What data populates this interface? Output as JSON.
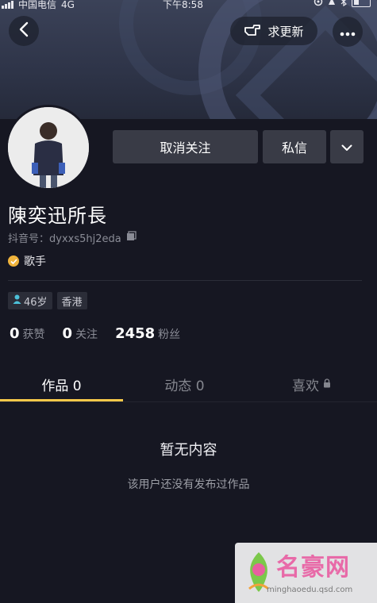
{
  "status_bar": {
    "carrier": "中国电信",
    "network": "4G",
    "time": "下午8:58"
  },
  "header": {
    "back_icon": "chevron-left-icon",
    "update_label": "求更新",
    "update_icon": "pointing-hand-icon",
    "more_icon": "more-dots-icon"
  },
  "actions": {
    "unfollow_label": "取消关注",
    "message_label": "私信",
    "dropdown_icon": "chevron-down-icon"
  },
  "profile": {
    "name": "陳奕迅所長",
    "douyin_id": "抖音号：dyxxs5hj2eda",
    "verify_label": "歌手",
    "tags": {
      "age": "46岁",
      "location": "香港"
    }
  },
  "stats": [
    {
      "num": "0",
      "label": "获赞"
    },
    {
      "num": "0",
      "label": "关注"
    },
    {
      "num": "2458",
      "label": "粉丝"
    }
  ],
  "tabs": [
    {
      "label": "作品 0",
      "active": true
    },
    {
      "label": "动态 0",
      "active": false
    },
    {
      "label": "喜欢",
      "active": false,
      "icon": "lock-icon"
    }
  ],
  "empty_state": {
    "title": "暂无内容",
    "subtitle": "该用户还没有发布过作品"
  },
  "watermark": {
    "text": "名豪网",
    "url": "minghaoedu.qsd.com"
  },
  "colors": {
    "background": "#161722",
    "button": "#393b46",
    "tab_indicator": "#f6c84a",
    "verify_badge": "#f0b43c"
  }
}
